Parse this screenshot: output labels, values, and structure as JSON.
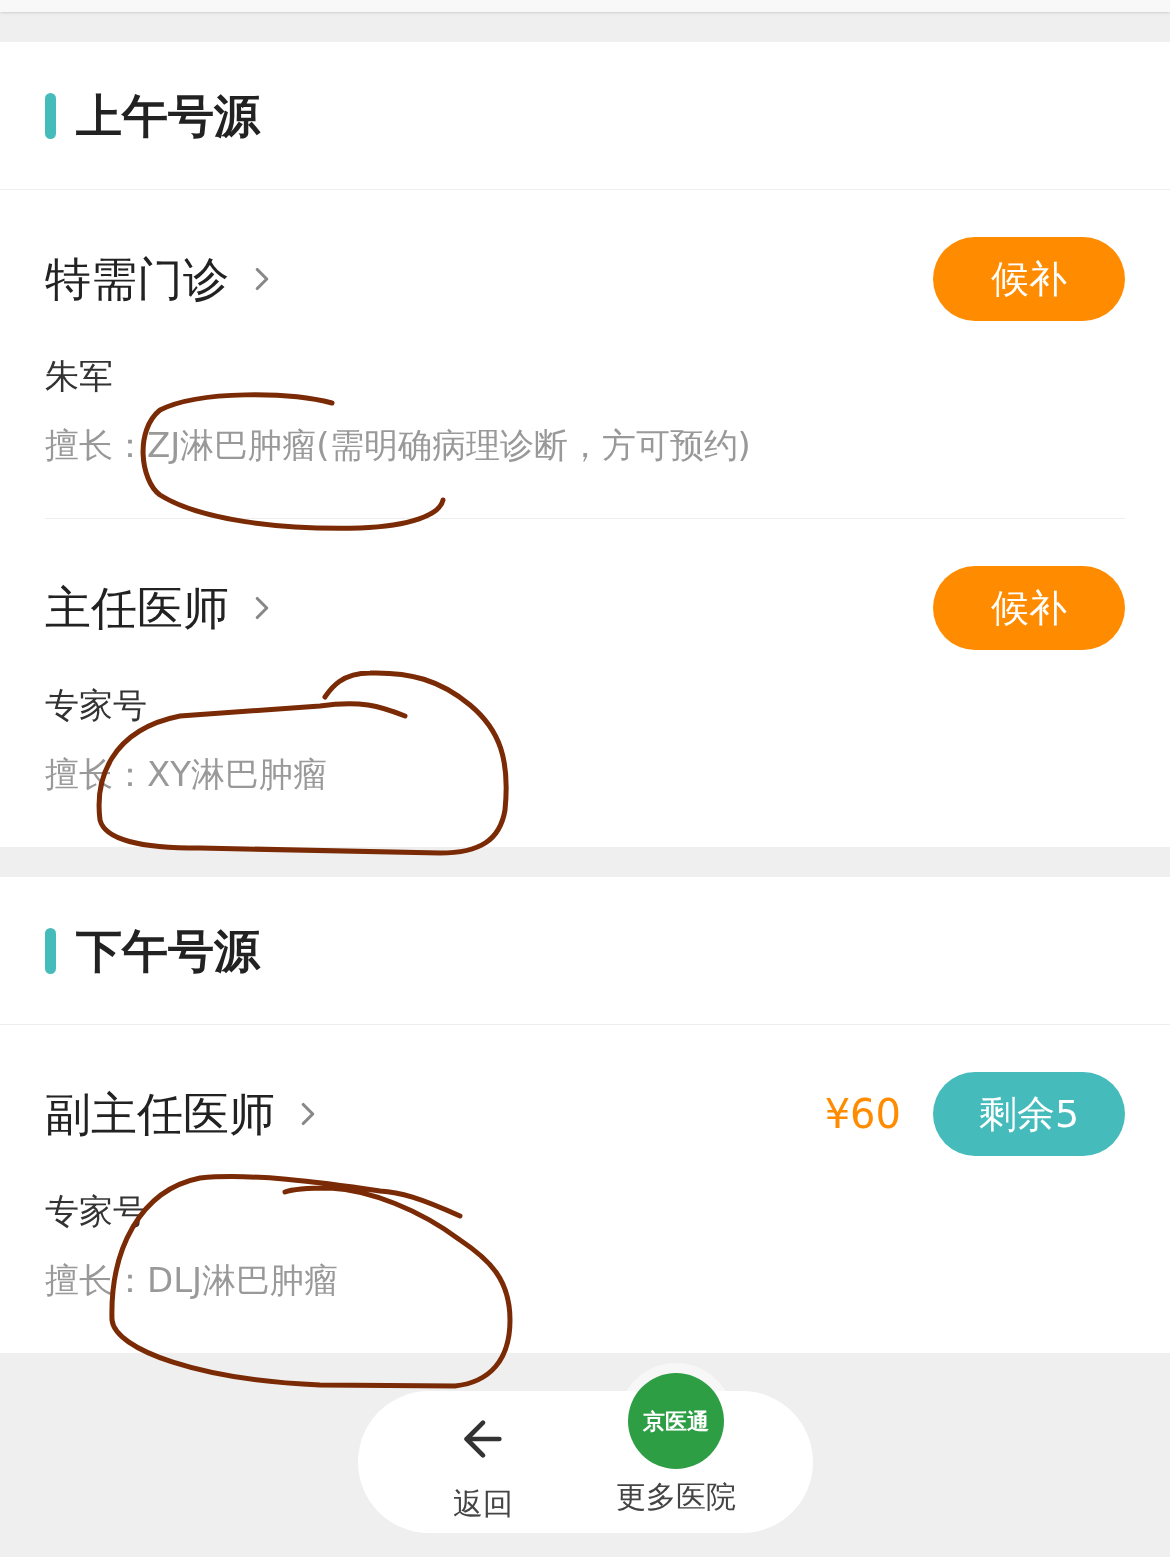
{
  "sections": [
    {
      "title": "上午号源",
      "rows": [
        {
          "title": "特需门诊",
          "subtitle": "朱军",
          "specialty": "擅长：ZJ淋巴肿瘤(需明确病理诊断，方可预约)",
          "button": {
            "label": "候补",
            "kind": "waitlist"
          }
        },
        {
          "title": "主任医师",
          "subtitle": "专家号",
          "specialty": "擅长：XY淋巴肿瘤",
          "button": {
            "label": "候补",
            "kind": "waitlist"
          }
        }
      ]
    },
    {
      "title": "下午号源",
      "rows": [
        {
          "title": "副主任医师",
          "subtitle": "专家号",
          "specialty": "擅长：DLJ淋巴肿瘤",
          "price": "¥60",
          "button": {
            "label": "剩余5",
            "kind": "available"
          }
        }
      ]
    }
  ],
  "bottom_bar": {
    "back": "返回",
    "logo": "京医通",
    "more": "更多医院"
  }
}
